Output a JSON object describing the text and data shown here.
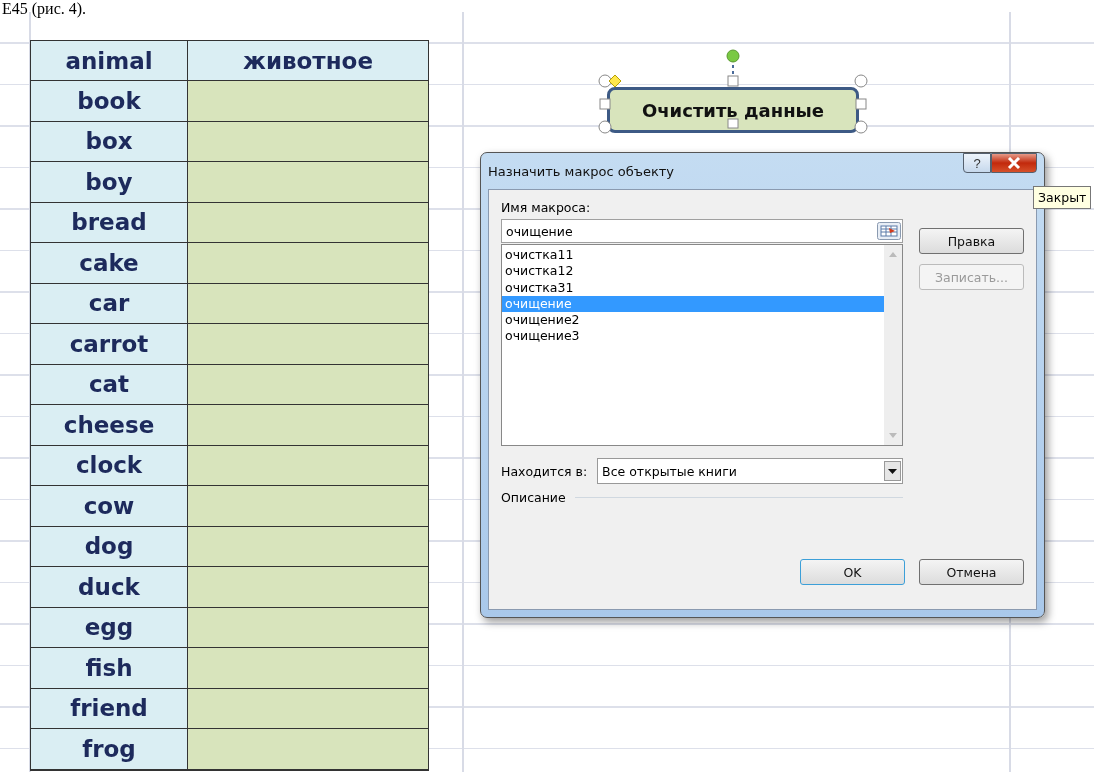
{
  "page_text": "Е45 (рис. 4).",
  "table": {
    "columns": [
      "animal",
      "животное"
    ],
    "rows": [
      {
        "word": "book"
      },
      {
        "word": "box"
      },
      {
        "word": "boy"
      },
      {
        "word": "bread"
      },
      {
        "word": "cake"
      },
      {
        "word": "car"
      },
      {
        "word": "carrot"
      },
      {
        "word": "cat"
      },
      {
        "word": "cheese"
      },
      {
        "word": "clock"
      },
      {
        "word": "cow"
      },
      {
        "word": "dog"
      },
      {
        "word": "duck"
      },
      {
        "word": "egg"
      },
      {
        "word": "fish"
      },
      {
        "word": "friend"
      },
      {
        "word": "frog"
      }
    ]
  },
  "shape": {
    "label": "Очистить данные",
    "selected": true
  },
  "dialog": {
    "title": "Назначить макрос объекту",
    "help_button": "?",
    "macro_name_label": "Имя макроса:",
    "macro_name": "очищение",
    "macros": [
      {
        "name": "очистка11",
        "selected": false
      },
      {
        "name": "очистка12",
        "selected": false
      },
      {
        "name": "очистка31",
        "selected": false
      },
      {
        "name": "очищение",
        "selected": true
      },
      {
        "name": "очищение2",
        "selected": false
      },
      {
        "name": "очищение3",
        "selected": false
      }
    ],
    "side_buttons": [
      {
        "label": "Правка",
        "disabled": false
      },
      {
        "label": "Записать...",
        "disabled": true
      }
    ],
    "location_label": "Находится в:",
    "location": "Все открытые книги",
    "description_label": "Описание",
    "ok": "OK",
    "cancel": "Отмена"
  },
  "tooltip": "Закрыт"
}
